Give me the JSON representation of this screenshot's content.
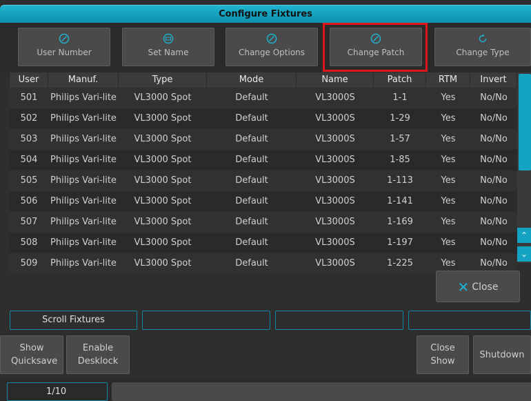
{
  "window": {
    "title": "Configure Fixtures"
  },
  "toolbar": {
    "buttons": [
      {
        "label": "User Number",
        "icon": "pencil-circle-icon"
      },
      {
        "label": "Set Name",
        "icon": "keyboard-circle-icon"
      },
      {
        "label": "Change Options",
        "icon": "pencil-circle-icon"
      },
      {
        "label": "Change Patch",
        "icon": "pencil-circle-icon",
        "highlighted": true
      },
      {
        "label": "Change Type",
        "icon": "refresh-icon"
      }
    ]
  },
  "table": {
    "columns": [
      "User",
      "Manuf.",
      "Type",
      "Mode",
      "Name",
      "Patch",
      "RTM",
      "Invert"
    ],
    "rows": [
      [
        "501",
        "Philips Vari-lite",
        "VL3000 Spot",
        "Default",
        "VL3000S",
        "1-1",
        "Yes",
        "No/No"
      ],
      [
        "502",
        "Philips Vari-lite",
        "VL3000 Spot",
        "Default",
        "VL3000S",
        "1-29",
        "Yes",
        "No/No"
      ],
      [
        "503",
        "Philips Vari-lite",
        "VL3000 Spot",
        "Default",
        "VL3000S",
        "1-57",
        "Yes",
        "No/No"
      ],
      [
        "504",
        "Philips Vari-lite",
        "VL3000 Spot",
        "Default",
        "VL3000S",
        "1-85",
        "Yes",
        "No/No"
      ],
      [
        "505",
        "Philips Vari-lite",
        "VL3000 Spot",
        "Default",
        "VL3000S",
        "1-113",
        "Yes",
        "No/No"
      ],
      [
        "506",
        "Philips Vari-lite",
        "VL3000 Spot",
        "Default",
        "VL3000S",
        "1-141",
        "Yes",
        "No/No"
      ],
      [
        "507",
        "Philips Vari-lite",
        "VL3000 Spot",
        "Default",
        "VL3000S",
        "1-169",
        "Yes",
        "No/No"
      ],
      [
        "508",
        "Philips Vari-lite",
        "VL3000 Spot",
        "Default",
        "VL3000S",
        "1-197",
        "Yes",
        "No/No"
      ],
      [
        "509",
        "Philips Vari-lite",
        "VL3000 Spot",
        "Default",
        "VL3000S",
        "1-225",
        "Yes",
        "No/No"
      ]
    ]
  },
  "actions": {
    "close_label": "Close"
  },
  "fields": {
    "scroll_fixtures": "Scroll Fixtures"
  },
  "bottom": {
    "show_quicksave": "Show Quicksave",
    "enable_desklock": "Enable Desklock",
    "close_show": "Close Show",
    "shutdown": "Shutdown"
  },
  "status": {
    "page": "1/10"
  },
  "colors": {
    "accent": "#14a4c2",
    "highlight": "#e0161d",
    "background": "#2e2e2e"
  }
}
